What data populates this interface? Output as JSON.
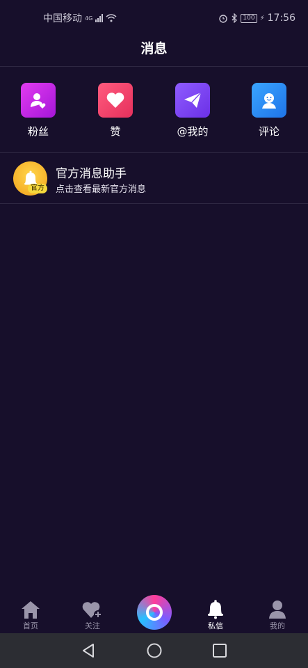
{
  "status_bar": {
    "carrier": "中国移动",
    "network": "4G",
    "battery": "100",
    "time": "17:56"
  },
  "header": {
    "title": "消息"
  },
  "quick_actions": [
    {
      "label": "粉丝",
      "icon": "fans-icon",
      "color": "#c31fe0"
    },
    {
      "label": "赞",
      "icon": "heart-icon",
      "color": "#f0416c"
    },
    {
      "label": "@我的",
      "icon": "paper-plane-icon",
      "color": "#7d4bf0"
    },
    {
      "label": "评论",
      "icon": "comment-face-icon",
      "color": "#2f8ff5"
    }
  ],
  "messages": [
    {
      "title": "官方消息助手",
      "subtitle": "点击查看最新官方消息",
      "badge": "官方",
      "avatar_icon": "bell-icon"
    }
  ],
  "tab_bar": {
    "tabs": [
      {
        "label": "首页",
        "icon": "home-icon",
        "active": false
      },
      {
        "label": "关注",
        "icon": "heart-plus-icon",
        "active": false
      },
      {
        "label": "",
        "icon": "camera-record-icon",
        "active": false
      },
      {
        "label": "私信",
        "icon": "bell-icon",
        "active": true
      },
      {
        "label": "我的",
        "icon": "person-icon",
        "active": false
      }
    ]
  },
  "system_nav": [
    "back-icon",
    "home-circle-icon",
    "recents-icon"
  ]
}
